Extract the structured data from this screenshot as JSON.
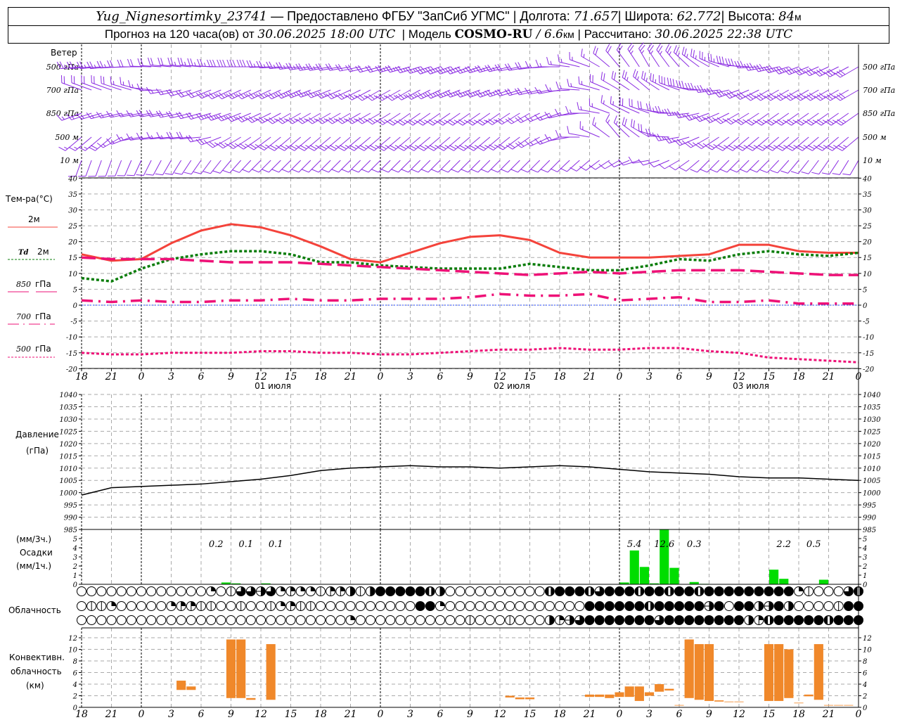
{
  "header": {
    "station": "Yug_Nignesortimky_23741",
    "provider": " — Предоставлено ФГБУ \"ЗапСиб УГМС\" ",
    "lon_label": " Долгота: ",
    "lon": "71.657",
    "lat_label": " Широта: ",
    "lat": "62.772",
    "alt_label": " Высота: ",
    "alt": "84",
    "alt_unit": "м",
    "forecast_label": "Прогноз на 120 часа(ов) от ",
    "forecast_time": "30.06.2025 18:00 UTC",
    "model_label": "  | Модель ",
    "model": "COSMO-RU",
    "resolution": " / 6.6",
    "resolution_unit": "км",
    "calc_label": " | Рассчитано: ",
    "calc_time": "30.06.2025 22:38 UTC",
    "sep": "|"
  },
  "wind": {
    "title": "Ветер",
    "levels": [
      {
        "label": "500 гПа",
        "dir": [
          265,
          265,
          270,
          275,
          275,
          270,
          270,
          265,
          260,
          260,
          255,
          255,
          250,
          250,
          255,
          260,
          270,
          290,
          320,
          330,
          320,
          300,
          280,
          260,
          250,
          245,
          240
        ],
        "speed": [
          12,
          12,
          10,
          10,
          12,
          14,
          14,
          12,
          12,
          10,
          10,
          12,
          14,
          14,
          12,
          10,
          8,
          8,
          10,
          12,
          12,
          12,
          14,
          14,
          14,
          14,
          14
        ]
      },
      {
        "label": "700 гПа",
        "dir": [
          290,
          290,
          285,
          260,
          250,
          245,
          245,
          245,
          250,
          245,
          240,
          240,
          245,
          250,
          250,
          255,
          260,
          280,
          300,
          310,
          290,
          270,
          250,
          240,
          240,
          240,
          240
        ],
        "speed": [
          10,
          10,
          8,
          8,
          10,
          12,
          12,
          12,
          12,
          12,
          12,
          12,
          12,
          12,
          12,
          10,
          8,
          8,
          10,
          12,
          14,
          14,
          14,
          14,
          14,
          14,
          14
        ]
      },
      {
        "label": "850 гПа",
        "dir": [
          250,
          255,
          260,
          260,
          255,
          250,
          245,
          240,
          240,
          240,
          240,
          235,
          235,
          235,
          235,
          240,
          250,
          270,
          300,
          290,
          270,
          250,
          240,
          235,
          235,
          235,
          235
        ],
        "speed": [
          8,
          8,
          8,
          10,
          10,
          12,
          12,
          12,
          12,
          12,
          12,
          12,
          12,
          12,
          12,
          10,
          8,
          8,
          8,
          10,
          12,
          12,
          12,
          12,
          12,
          12,
          12
        ]
      },
      {
        "label": "500 м",
        "dir": [
          230,
          230,
          260,
          265,
          265,
          240,
          235,
          230,
          230,
          230,
          230,
          230,
          230,
          230,
          230,
          235,
          250,
          280,
          320,
          300,
          260,
          240,
          230,
          230,
          230,
          230,
          230
        ],
        "speed": [
          8,
          9,
          8,
          8,
          10,
          12,
          12,
          12,
          12,
          12,
          12,
          12,
          12,
          12,
          12,
          10,
          8,
          6,
          8,
          10,
          12,
          12,
          12,
          12,
          12,
          12,
          12
        ]
      },
      {
        "label": "10   м",
        "dir": [
          200,
          200,
          205,
          210,
          215,
          220,
          225,
          225,
          225,
          225,
          225,
          225,
          225,
          225,
          225,
          225,
          225,
          230,
          240,
          260,
          240,
          225,
          225,
          225,
          220,
          215,
          210
        ],
        "speed": [
          4,
          5,
          5,
          6,
          6,
          6,
          6,
          6,
          6,
          6,
          6,
          6,
          6,
          6,
          6,
          6,
          6,
          4,
          4,
          5,
          6,
          6,
          6,
          6,
          6,
          6,
          5
        ]
      }
    ],
    "color": "#8a2be2"
  },
  "time_axis": {
    "labels": [
      "18",
      "21",
      "0",
      "3",
      "6",
      "9",
      "12",
      "15",
      "18",
      "21",
      "0",
      "3",
      "6",
      "9",
      "12",
      "15",
      "18",
      "21",
      "0",
      "3",
      "6",
      "9",
      "12",
      "15",
      "18",
      "21",
      "0"
    ],
    "dates": [
      "01 июля",
      "02 июля",
      "03 июля"
    ]
  },
  "legend": {
    "temp_title": "Тем-ра(°C)",
    "t2m": "2м",
    "td_a": "Td",
    "td_b": "2м",
    "t850_a": "850",
    "t850_b": "гПа",
    "t700_a": "700",
    "t700_b": "гПа",
    "t500_a": "500",
    "t500_b": "гПа",
    "pressure_a": "Давление",
    "pressure_b": "(гПа)",
    "precip_a": "(мм/3ч.)",
    "precip_b": "Осадки",
    "precip_c": "(мм/1ч.)",
    "cloud": "Облачность",
    "conv_a": "Конвективн.",
    "conv_b": "облачность",
    "conv_c": "(км)"
  },
  "chart_data": [
    {
      "type": "line",
      "title": "Тем-ра(°C)",
      "x_step_hours": 3,
      "ylim": [
        -20,
        40
      ],
      "yticks": [
        40,
        35,
        30,
        25,
        20,
        15,
        10,
        5,
        0,
        -5,
        -10,
        -15,
        -20
      ],
      "grid": true,
      "series": [
        {
          "name": "2м",
          "color": "#f4433b",
          "values": [
            16,
            14,
            14.5,
            19.5,
            23.5,
            25.5,
            24.5,
            22,
            18.5,
            14.5,
            13.5,
            16.5,
            19.5,
            21.5,
            22,
            20.5,
            16.5,
            15,
            15,
            15,
            15.5,
            16,
            19,
            19,
            17,
            16.5,
            16.5
          ]
        },
        {
          "name": "Td 2м",
          "color": "#0a7d0a",
          "values": [
            8.5,
            7.5,
            11.5,
            14.5,
            16,
            17,
            17,
            16,
            13.5,
            13.5,
            12.5,
            12,
            11.5,
            11.5,
            11.5,
            13,
            12,
            11,
            11,
            12.5,
            14.5,
            14,
            16,
            17,
            16,
            15.5,
            16.5
          ]
        },
        {
          "name": "850 гПа",
          "color": "#ee1177",
          "values": [
            15,
            14.5,
            14.5,
            14.5,
            14,
            13.5,
            13.5,
            13.5,
            13,
            12.5,
            12,
            11.5,
            11,
            10.5,
            10,
            9.5,
            10,
            10.5,
            10,
            10.5,
            11,
            11,
            11,
            10.5,
            10,
            9.5,
            9.5
          ]
        },
        {
          "name": "700 гПа",
          "color": "#ee1177",
          "values": [
            1.5,
            1,
            1.5,
            1,
            1,
            1.5,
            1.5,
            2,
            1.5,
            1.5,
            2,
            2,
            2,
            2.5,
            3.5,
            3,
            3,
            3.5,
            1.5,
            2,
            2.5,
            1,
            1,
            1.5,
            0.5,
            0.5,
            0.5
          ]
        },
        {
          "name": "500 гПа",
          "color": "#ee1177",
          "values": [
            -15,
            -15.5,
            -15.5,
            -15,
            -15,
            -15,
            -14.5,
            -14.5,
            -15,
            -15,
            -15.5,
            -15.5,
            -15,
            -14.5,
            -14,
            -14,
            -13.5,
            -14,
            -14,
            -13.5,
            -13.5,
            -14.5,
            -15,
            -16.5,
            -17,
            -17.5,
            -18
          ]
        }
      ]
    },
    {
      "type": "line",
      "title": "Давление (гПа)",
      "x_step_hours": 3,
      "ylim": [
        985,
        1040
      ],
      "yticks": [
        1040,
        1035,
        1030,
        1025,
        1020,
        1015,
        1010,
        1005,
        1000,
        995,
        990,
        985
      ],
      "grid": true,
      "series": [
        {
          "color": "#000000",
          "values": [
            999,
            1002,
            1002.5,
            1003,
            1003.5,
            1004.5,
            1005.5,
            1007,
            1009,
            1010,
            1010.5,
            1011,
            1010.5,
            1010.5,
            1010,
            1010.5,
            1011,
            1010.5,
            1009.5,
            1008.5,
            1008,
            1007.5,
            1006.5,
            1006,
            1006,
            1005.5,
            1005
          ]
        }
      ]
    },
    {
      "type": "bar",
      "title": "Осадки",
      "ylim": [
        0,
        5.9
      ],
      "yticks": [
        0,
        1,
        2,
        3,
        4,
        5
      ],
      "color": "#00dd00",
      "hourly_mm": [
        [
          14,
          0.2
        ],
        [
          15,
          0.1
        ],
        [
          18,
          0.1
        ],
        [
          54,
          0.2
        ],
        [
          55,
          3.7
        ],
        [
          56,
          1.9
        ],
        [
          57,
          0.1
        ],
        [
          58,
          10.7
        ],
        [
          59,
          1.8
        ],
        [
          61,
          0.25
        ],
        [
          62,
          0.05
        ],
        [
          69,
          1.6
        ],
        [
          70,
          0.6
        ],
        [
          74,
          0.5
        ]
      ],
      "sums_3h": [
        {
          "end_hour": 15,
          "label": "0.2"
        },
        {
          "end_hour": 18,
          "label": "0.1"
        },
        {
          "end_hour": 21,
          "label": "0.1"
        },
        {
          "end_hour": 57,
          "label": "5.4"
        },
        {
          "end_hour": 60,
          "label": "12.6"
        },
        {
          "end_hour": 63,
          "label": "0.3"
        },
        {
          "end_hour": 72,
          "label": "2.2"
        },
        {
          "end_hour": 75,
          "label": "0.5"
        }
      ]
    },
    {
      "type": "table",
      "title": "Облачность",
      "encoding": "okta per hour 0-8",
      "rows": [
        "0000000000000201665623221334148888874000000000078887688878878878888888882100067",
        "0112000002331100100123110000000000882000000000000008888887888885808845840000188",
        "0000000000000000000000000002000000000001000100043568888888688888888437888887888"
      ]
    },
    {
      "type": "bar",
      "title": "Конвективн. облачность (км)",
      "ylim": [
        0,
        13.5
      ],
      "yticks": [
        0,
        2,
        4,
        6,
        8,
        10,
        12
      ],
      "color": "#f0882a",
      "bars_hour_base_top": [
        [
          10,
          3,
          4.6
        ],
        [
          11,
          3,
          3.6
        ],
        [
          15,
          1.6,
          11.7
        ],
        [
          16,
          1.6,
          11.7
        ],
        [
          17,
          1.3,
          1.6
        ],
        [
          19,
          1.3,
          10.9
        ],
        [
          43,
          1.7,
          2.0
        ],
        [
          44,
          1.4,
          1.7
        ],
        [
          45,
          1.4,
          1.7
        ],
        [
          51,
          1.8,
          2.2
        ],
        [
          52,
          1.8,
          2.2
        ],
        [
          53,
          1.6,
          2.2
        ],
        [
          54,
          1.8,
          2.6
        ],
        [
          55,
          1.8,
          3.6
        ],
        [
          56,
          1.1,
          3.6
        ],
        [
          57,
          2.0,
          2.6
        ],
        [
          58,
          2.7,
          4.0
        ],
        [
          59,
          2.9,
          3.2
        ],
        [
          60,
          0.3,
          0.4
        ],
        [
          61,
          1.6,
          11.7
        ],
        [
          62,
          1.3,
          10.9
        ],
        [
          63,
          1.1,
          10.9
        ],
        [
          64,
          1.0,
          1.2
        ],
        [
          65,
          0.9,
          1.0
        ],
        [
          66,
          0.9,
          1.0
        ],
        [
          69,
          1.1,
          10.9
        ],
        [
          70,
          1.1,
          10.9
        ],
        [
          71,
          1.6,
          10.0
        ],
        [
          72,
          0.7,
          0.8
        ],
        [
          73,
          1.9,
          2.2
        ],
        [
          74,
          1.3,
          10.9
        ],
        [
          75,
          0.3,
          0.4
        ],
        [
          76,
          0.3,
          0.4
        ],
        [
          77,
          0.3,
          0.4
        ]
      ]
    }
  ]
}
